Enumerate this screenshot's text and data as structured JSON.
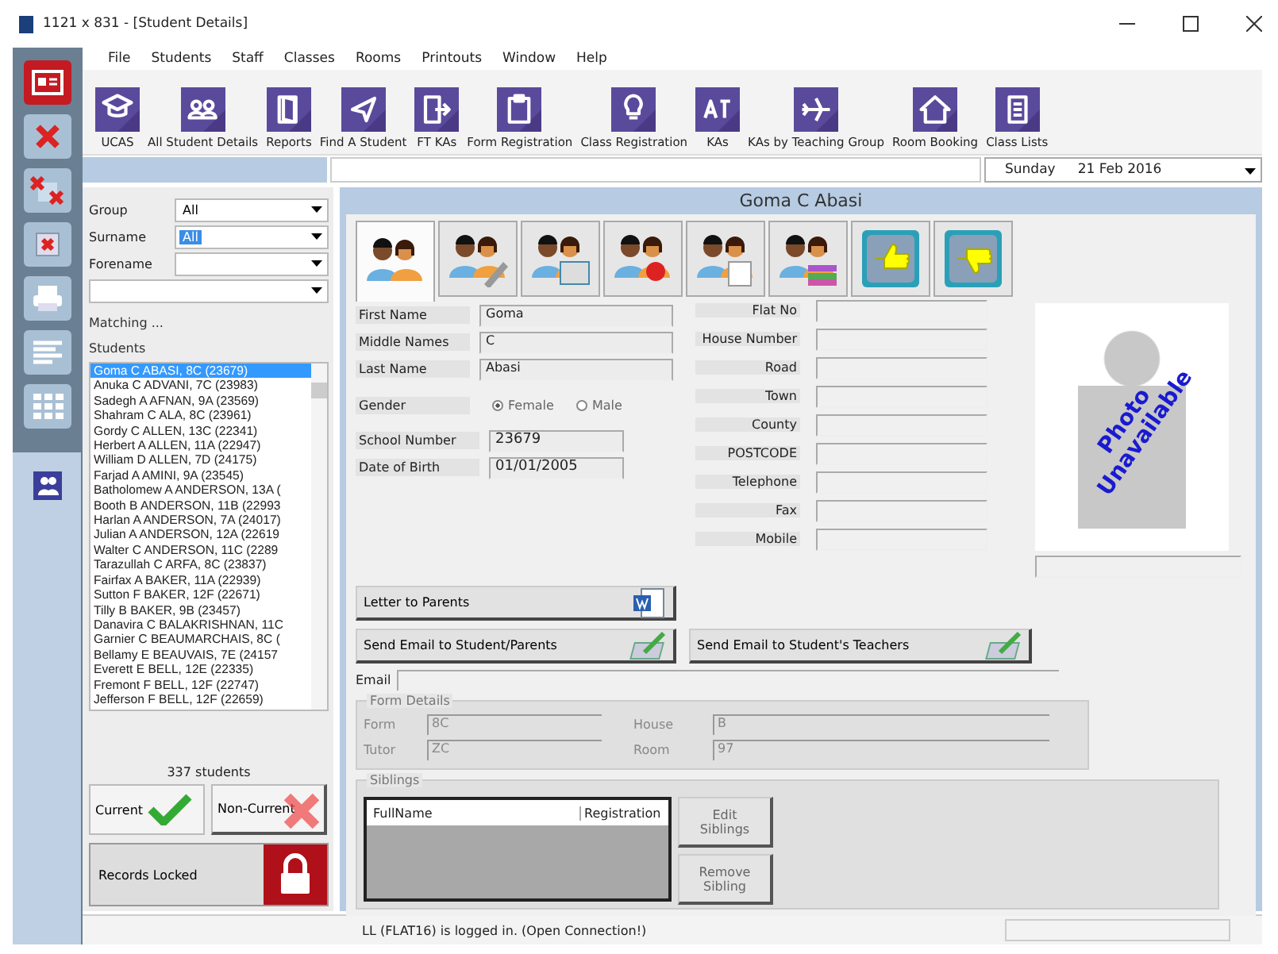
{
  "window": {
    "title": "1121 x 831 - [Student Details]"
  },
  "menu": [
    "File",
    "Students",
    "Staff",
    "Classes",
    "Rooms",
    "Printouts",
    "Window",
    "Help"
  ],
  "toolbar": [
    {
      "label": "UCAS"
    },
    {
      "label": "All Student Details"
    },
    {
      "label": "Reports"
    },
    {
      "label": "Find A Student"
    },
    {
      "label": "FT KAs"
    },
    {
      "label": "Form Registration"
    },
    {
      "label": "Class Registration"
    },
    {
      "label": "KAs"
    },
    {
      "label": "KAs by Teaching Group"
    },
    {
      "label": "Room Booking"
    },
    {
      "label": "Class Lists"
    }
  ],
  "date_picker": {
    "day": "Sunday",
    "date": "21 Feb 2016"
  },
  "side_tools": [
    {
      "selected": true
    },
    {
      "selected": false
    },
    {
      "selected": false
    },
    {
      "selected": false
    },
    {
      "selected": false
    },
    {
      "selected": false
    },
    {
      "selected": false
    }
  ],
  "module_button": {
    "selected": true
  },
  "filters": [
    {
      "kind": "labelled",
      "label": "Group",
      "value": "All",
      "highlighted": false
    },
    {
      "kind": "labelled",
      "label": "Surname",
      "value": "All",
      "highlighted": true
    },
    {
      "kind": "labelled",
      "label": "Forename"
    },
    {
      "kind": "plain"
    }
  ],
  "matching_label": "Matching ...",
  "students_label": "Students",
  "students": [
    {
      "text": "Goma C ABASI, 8C (23679)",
      "selected": true
    },
    {
      "text": "Anuka C ADVANI, 7C (23983)",
      "selected": false
    },
    {
      "text": "Sadegh A AFNAN, 9A (23569)",
      "selected": false
    },
    {
      "text": "Shahram C ALA, 8C (23961)",
      "selected": false
    },
    {
      "text": "Gordy C ALLEN, 13C (22341)",
      "selected": false
    },
    {
      "text": "Herbert A ALLEN, 11A (22947)",
      "selected": false
    },
    {
      "text": "William D ALLEN, 7D (24175)",
      "selected": false
    },
    {
      "text": "Farjad A AMINI, 9A (23545)",
      "selected": false
    },
    {
      "text": "Batholomew A ANDERSON, 13A (",
      "selected": false
    },
    {
      "text": "Booth B ANDERSON, 11B (22993",
      "selected": false
    },
    {
      "text": "Harlan A ANDERSON, 7A (24017)",
      "selected": false
    },
    {
      "text": "Julian A ANDERSON, 12A (22619",
      "selected": false
    },
    {
      "text": "Walter C ANDERSON, 11C (2289",
      "selected": false
    },
    {
      "text": "Tarazullah C ARFA, 8C (23837)",
      "selected": false
    },
    {
      "text": "Fairfax A BAKER, 11A (22939)",
      "selected": false
    },
    {
      "text": "Sutton F BAKER, 12F (22671)",
      "selected": false
    },
    {
      "text": "Tilly B BAKER, 9B (23457)",
      "selected": false
    },
    {
      "text": "Danavira C BALAKRISHNAN, 11C",
      "selected": false
    },
    {
      "text": "Garnier C BEAUMARCHAIS, 8C (",
      "selected": false
    },
    {
      "text": "Bellamy E BEAUVAIS, 7E (24157",
      "selected": false
    },
    {
      "text": "Everett E BELL, 12E (22335)",
      "selected": false
    },
    {
      "text": "Fremont F BELL, 12F (22747)",
      "selected": false
    },
    {
      "text": "Jefferson F BELL, 12F (22659)",
      "selected": false
    }
  ],
  "student_count": "337 students",
  "current_button": "Current",
  "non_current_button": "Non-Current",
  "records_locked": "Records Locked",
  "student_name": "Goma C Abasi",
  "tabs": [
    {
      "selected": true
    },
    {
      "selected": false
    },
    {
      "selected": false
    },
    {
      "selected": false
    },
    {
      "selected": false
    },
    {
      "selected": false
    },
    {
      "selected": false
    },
    {
      "selected": false
    }
  ],
  "names": [
    {
      "label": "First Name",
      "value": "Goma"
    },
    {
      "label": "Middle Names",
      "value": "C"
    },
    {
      "label": "Last Name",
      "value": "Abasi"
    }
  ],
  "gender": {
    "label": "Gender",
    "options": [
      {
        "label": "Female",
        "selected": true
      },
      {
        "label": "Male",
        "selected": false
      }
    ]
  },
  "ids": [
    {
      "label": "School Number",
      "value": "23679"
    },
    {
      "label": "Date of Birth",
      "value": "01/01/2005"
    }
  ],
  "address": [
    "Flat No",
    "House Number",
    "Road",
    "Town",
    "County",
    "POSTCODE",
    "Telephone",
    "Fax",
    "Mobile"
  ],
  "photo_text": "Photo Unavailable",
  "letter_button": "Letter to Parents",
  "email_parents_button": "Send Email to Student/Parents",
  "email_teachers_button": "Send Email to Student's Teachers",
  "email_label": "Email",
  "form_details": {
    "title": "Form Details",
    "fields": [
      {
        "label": "Form",
        "value": "8C"
      },
      {
        "label": "House",
        "value": "B"
      },
      {
        "label": "Tutor",
        "value": "ZC"
      },
      {
        "label": "Room",
        "value": "97"
      }
    ]
  },
  "siblings": {
    "title": "Siblings",
    "columns": [
      "FullName",
      "Registration"
    ],
    "buttons": [
      "Edit Siblings",
      "Remove Sibling"
    ]
  },
  "status": "LL (FLAT16) is logged in. (Open Connection!)"
}
